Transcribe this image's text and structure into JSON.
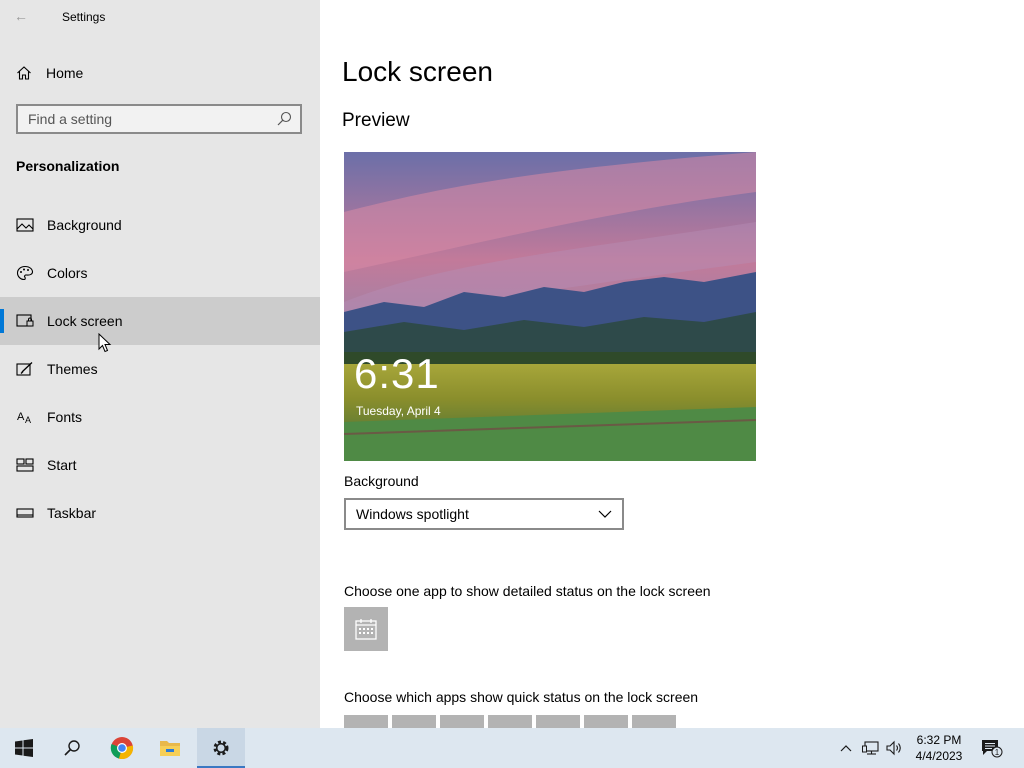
{
  "window": {
    "title": "Settings"
  },
  "sidebar": {
    "home_label": "Home",
    "search_placeholder": "Find a setting",
    "section_title": "Personalization",
    "items": [
      {
        "label": "Background",
        "icon": "picture-icon",
        "active": false
      },
      {
        "label": "Colors",
        "icon": "palette-icon",
        "active": false
      },
      {
        "label": "Lock screen",
        "icon": "lock-screen-icon",
        "active": true
      },
      {
        "label": "Themes",
        "icon": "brush-icon",
        "active": false
      },
      {
        "label": "Fonts",
        "icon": "fonts-icon",
        "active": false
      },
      {
        "label": "Start",
        "icon": "start-icon",
        "active": false
      },
      {
        "label": "Taskbar",
        "icon": "taskbar-icon",
        "active": false
      }
    ],
    "accent_color": "#0078d7"
  },
  "main": {
    "page_title": "Lock screen",
    "preview_heading": "Preview",
    "preview_time": "6:31",
    "preview_date": "Tuesday, April 4",
    "background_label": "Background",
    "background_value": "Windows spotlight",
    "detailed_status_label": "Choose one app to show detailed status on the lock screen",
    "detailed_status_app_icon": "calendar-icon",
    "quick_status_label": "Choose which apps show quick status on the lock screen"
  },
  "taskbar": {
    "apps": [
      "start-icon",
      "search-icon",
      "chrome-icon",
      "file-explorer-icon",
      "settings-icon"
    ],
    "active_app": "settings-icon",
    "time": "6:32 PM",
    "date": "4/4/2023",
    "notification_count": "1"
  }
}
